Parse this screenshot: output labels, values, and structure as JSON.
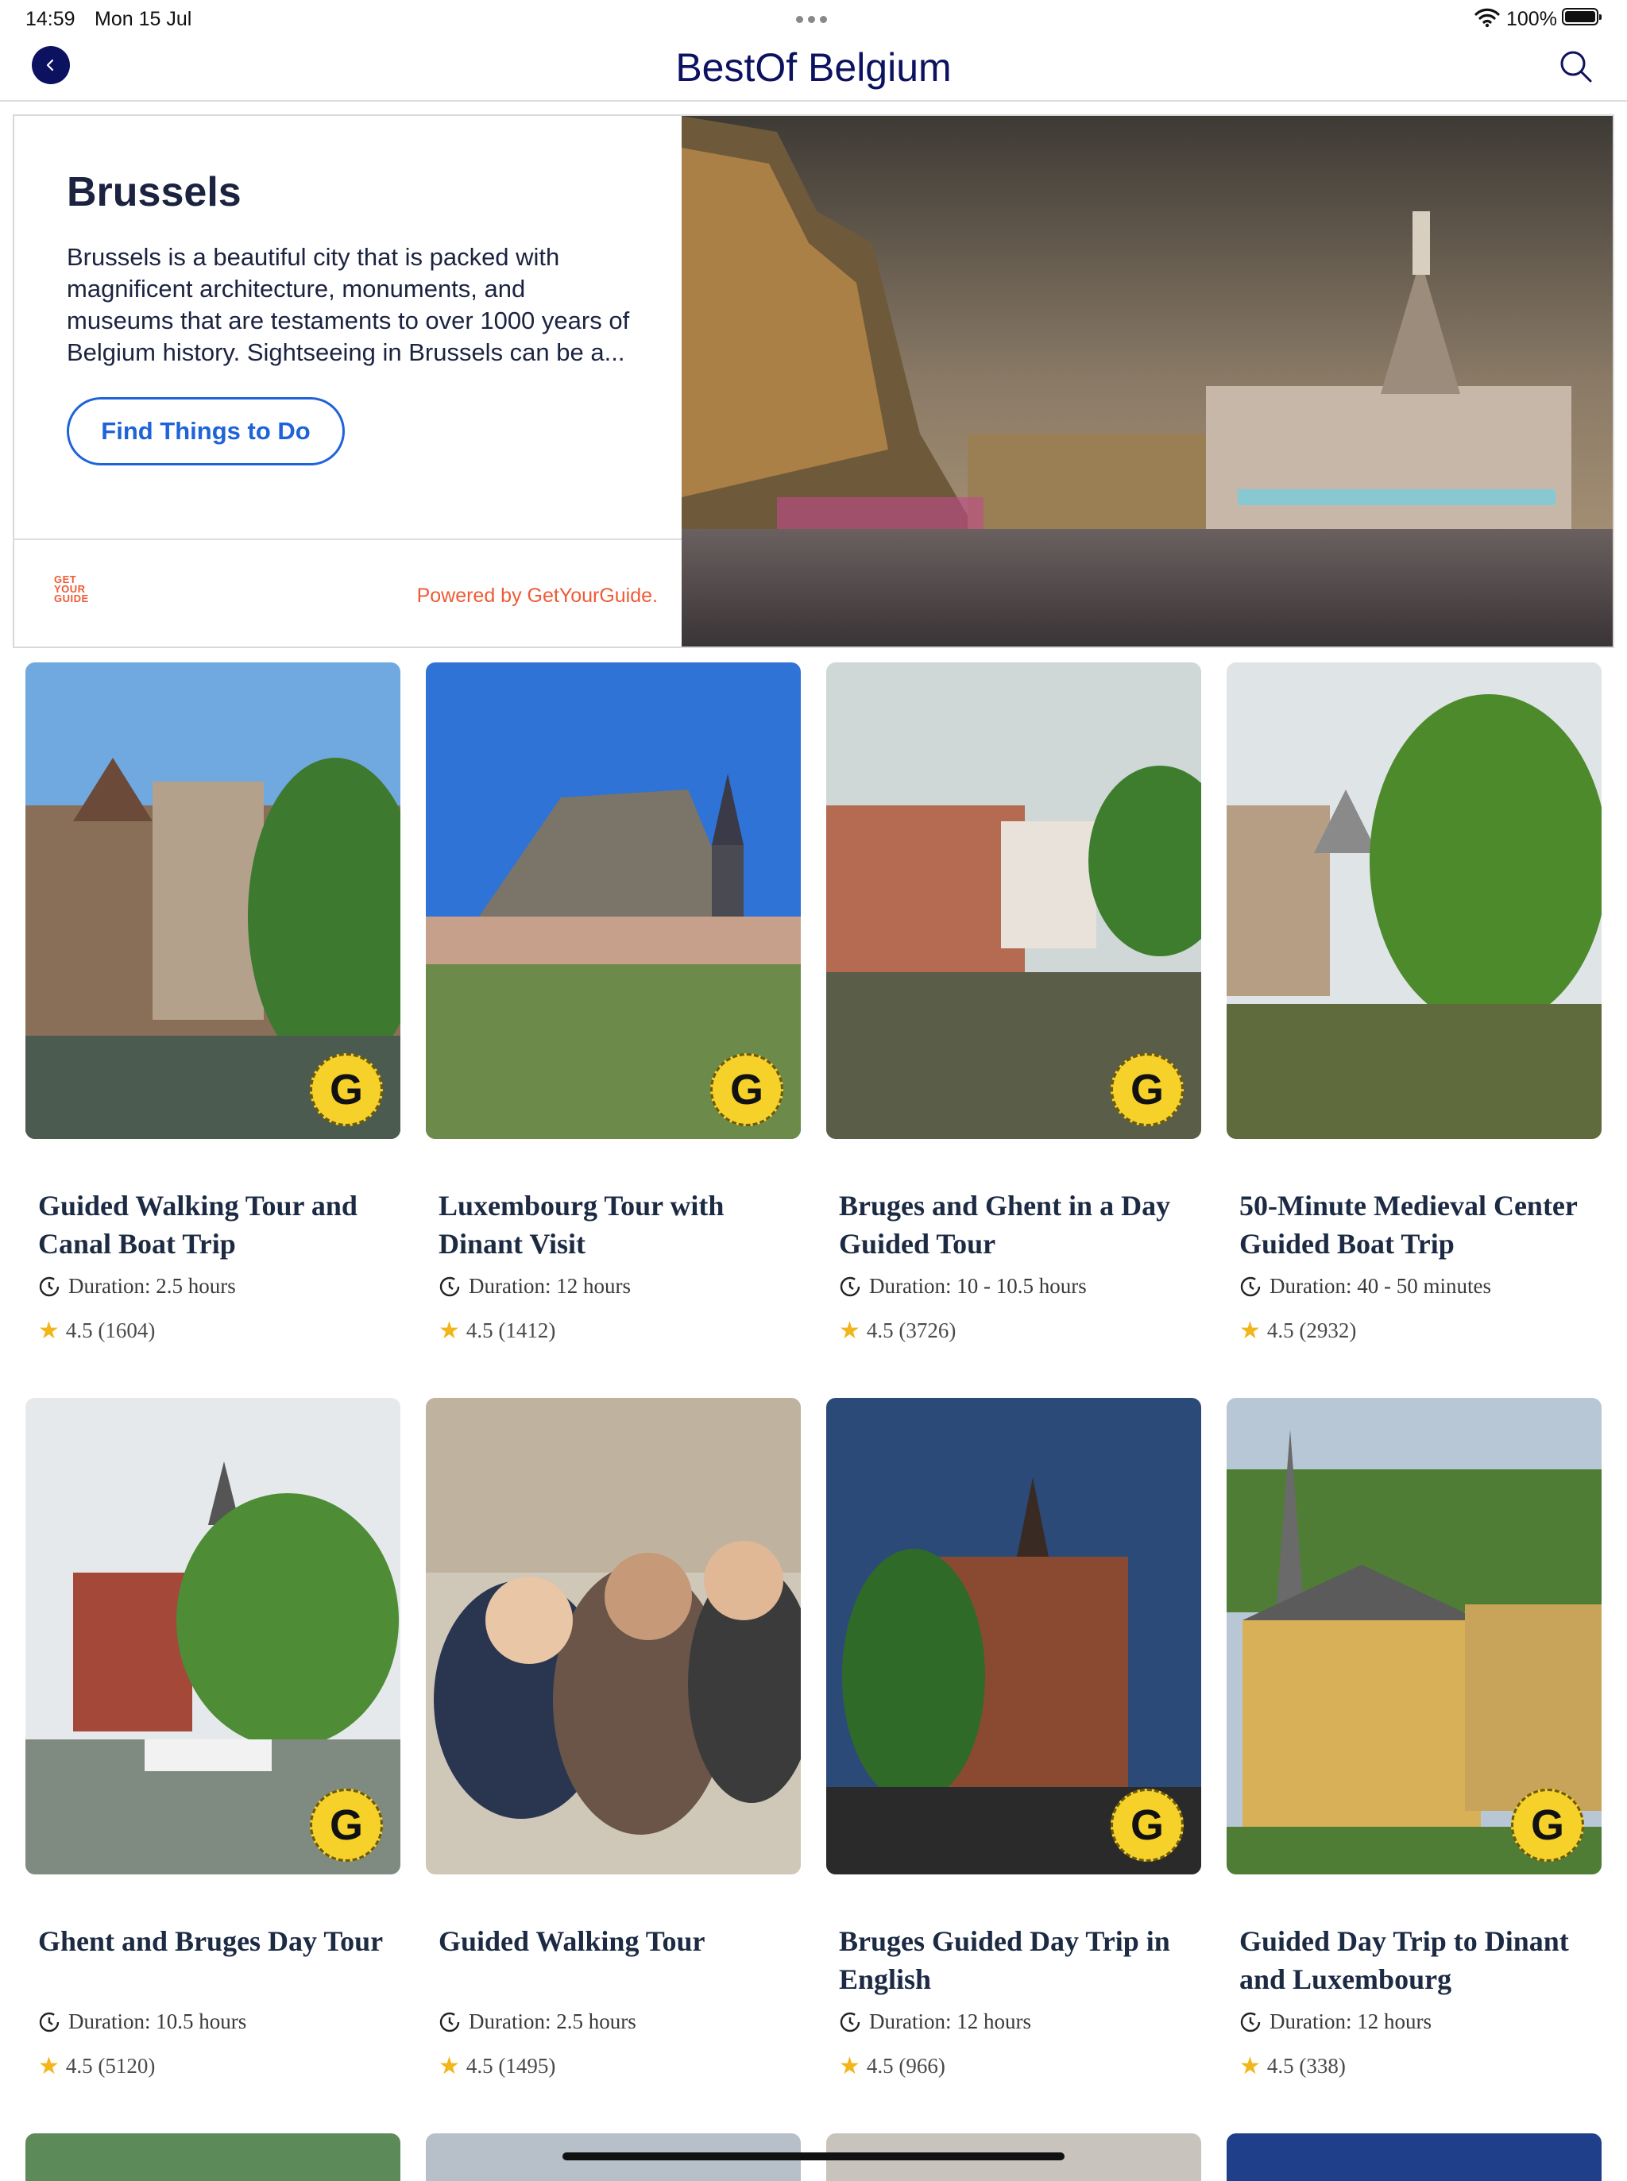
{
  "status_bar": {
    "time": "14:59",
    "date": "Mon 15 Jul",
    "battery": "100%"
  },
  "nav": {
    "title": "BestOf Belgium"
  },
  "hero": {
    "title": "Brussels",
    "description": "Brussels is a beautiful city that is packed with magnificent architecture, monuments, and museums that are testaments to over 1000 years of Belgium history. Sightseeing in Brussels can be a...",
    "button_label": "Find Things to Do",
    "logo_text": [
      "GET",
      "YOUR",
      "GUIDE"
    ],
    "powered_by": "Powered by GetYourGuide."
  },
  "badge_letter": "G",
  "cards": [
    {
      "title": "Guided Walking Tour and Canal Boat Trip",
      "duration": "Duration: 2.5 hours",
      "rating": "4.5 (1604)",
      "badge": true
    },
    {
      "title": "Luxembourg Tour with Dinant Visit",
      "duration": "Duration: 12 hours",
      "rating": "4.5 (1412)",
      "badge": true
    },
    {
      "title": "Bruges and Ghent in a Day Guided Tour",
      "duration": "Duration: 10 - 10.5 hours",
      "rating": "4.5 (3726)",
      "badge": true
    },
    {
      "title": "50-Minute Medieval Center Guided Boat Trip",
      "duration": "Duration: 40 - 50 minutes",
      "rating": "4.5 (2932)",
      "badge": false
    },
    {
      "title": "Ghent and Bruges Day Tour",
      "duration": "Duration: 10.5 hours",
      "rating": "4.5 (5120)",
      "badge": true
    },
    {
      "title": "Guided Walking Tour",
      "duration": "Duration: 2.5 hours",
      "rating": "4.5 (1495)",
      "badge": false
    },
    {
      "title": "Bruges Guided Day Trip in English",
      "duration": "Duration: 12 hours",
      "rating": "4.5 (966)",
      "badge": true
    },
    {
      "title": "Guided Day Trip to Dinant and Luxembourg",
      "duration": "Duration: 12 hours",
      "rating": "4.5 (338)",
      "badge": true
    }
  ]
}
